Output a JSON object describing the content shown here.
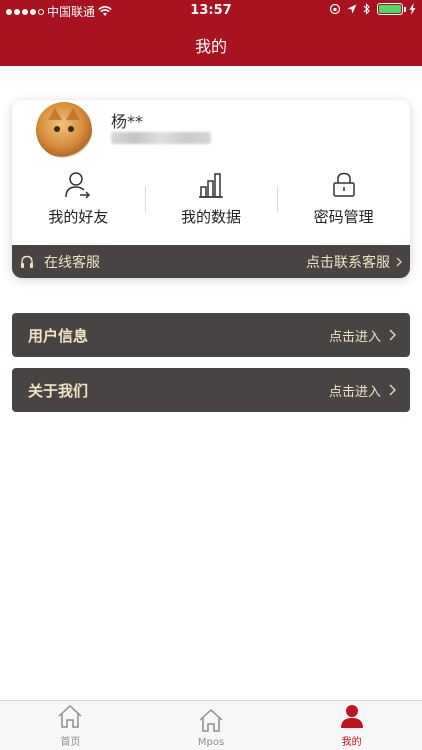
{
  "status_bar": {
    "carrier": "中国联通",
    "time": "13:57"
  },
  "nav": {
    "title": "我的"
  },
  "profile": {
    "name": "杨**"
  },
  "actions": [
    {
      "label": "我的好友",
      "icon": "user-share-icon"
    },
    {
      "label": "我的数据",
      "icon": "bar-chart-icon"
    },
    {
      "label": "密码管理",
      "icon": "lock-icon"
    }
  ],
  "service": {
    "label": "在线客服",
    "action": "点击联系客服"
  },
  "rows": [
    {
      "title": "用户信息",
      "action": "点击进入"
    },
    {
      "title": "关于我们",
      "action": "点击进入"
    }
  ],
  "tabs": [
    {
      "label": "首页",
      "icon": "home-icon"
    },
    {
      "label": "Mpos",
      "icon": "home-icon"
    },
    {
      "label": "我的",
      "icon": "person-icon"
    }
  ],
  "colors": {
    "brand_red": "#a8131f",
    "dark_panel": "#474443",
    "gold_text": "#f1e2c2",
    "tab_active": "#c1121f"
  }
}
